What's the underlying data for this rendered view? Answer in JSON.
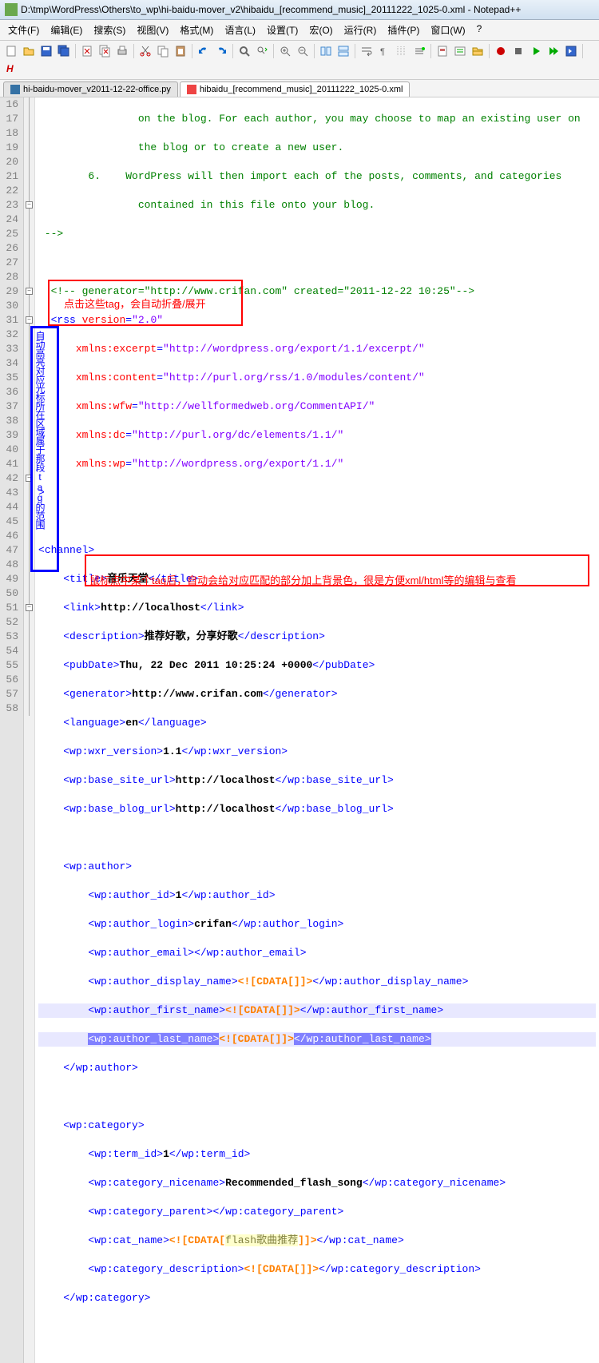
{
  "window": {
    "title": "D:\\tmp\\WordPress\\Others\\to_wp\\hi-baidu-mover_v2\\hibaidu_[recommend_music]_20111222_1025-0.xml - Notepad++"
  },
  "menu": {
    "items": [
      "文件(F)",
      "编辑(E)",
      "搜索(S)",
      "视图(V)",
      "格式(M)",
      "语言(L)",
      "设置(T)",
      "宏(O)",
      "运行(R)",
      "插件(P)",
      "窗口(W)",
      "?"
    ]
  },
  "tabs": {
    "items": [
      {
        "label": "hi-baidu-mover_v2011-12-22-office.py",
        "active": false,
        "type": "py"
      },
      {
        "label": "hibaidu_[recommend_music]_20111222_1025-0.xml",
        "active": true,
        "type": "xml"
      }
    ]
  },
  "annotations": {
    "red1": "点击这些tag，会自动折叠/展开",
    "blue": "自动高亮对应光标所在区域属于那段tag的范围",
    "red2": "鼠标点中某个tag后，自动会给对应匹配的部分加上背景色，很是方便xml/html等的编辑与查看"
  },
  "gutter": {
    "start": 16,
    "end": 58
  },
  "code": {
    "l16": "        on the blog. For each author, you may choose to map an existing user on",
    "l17": "        the blog or to create a new user.",
    "l18": "    6.    WordPress will then import each of the posts, comments, and categories",
    "l19": "        contained in this file onto your blog.",
    "l20": " -->",
    "l21": "",
    "l22t": "<!-- generator=\"http://www.crifan.com\" created=\"2011-12-22 10:25\"-->",
    "l23a": "rss",
    "l23b": "version",
    "l23c": "\"2.0\"",
    "l24a": "xmlns:excerpt",
    "l24b": "\"http://wordpress.org/export/1.1/excerpt/\"",
    "l25a": "xmlns:content",
    "l25b": "\"http://purl.org/rss/1.0/modules/content/\"",
    "l26a": "xmlns:wfw",
    "l26b": "\"http://wellformedweb.org/CommentAPI/\"",
    "l27a": "xmlns:dc",
    "l27b": "\"http://purl.org/dc/elements/1.1/\"",
    "l28a": "xmlns:wp",
    "l28b": "\"http://wordpress.org/export/1.1/\"",
    "l29": ">",
    "l31": "channel",
    "l32a": "title",
    "l32t": "音乐天堂",
    "l33a": "link",
    "l33t": "http://localhost",
    "l34a": "description",
    "l34t": "推荐好歌，分享好歌",
    "l35a": "pubDate",
    "l35t": "Thu, 22 Dec 2011 10:25:24 +0000",
    "l36a": "generator",
    "l36t": "http://www.crifan.com",
    "l37a": "language",
    "l37t": "en",
    "l38a": "wp:wxr_version",
    "l38t": "1.1",
    "l39a": "wp:base_site_url",
    "l39t": "http://localhost",
    "l40a": "wp:base_blog_url",
    "l40t": "http://localhost",
    "l42": "wp:author",
    "l43a": "wp:author_id",
    "l43t": "1",
    "l44a": "wp:author_login",
    "l44t": "crifan",
    "l45a": "wp:author_email",
    "l46a": "wp:author_display_name",
    "l46c": "<![CDATA[]]>",
    "l47a": "wp:author_first_name",
    "l47c": "<![CDATA[]]>",
    "l48a": "wp:author_last_name",
    "l48c": "<![CDATA[]]>",
    "l49": "wp:author",
    "l51": "wp:category",
    "l52a": "wp:term_id",
    "l52t": "1",
    "l53a": "wp:category_nicename",
    "l53t": "Recommended_flash_song",
    "l54a": "wp:category_parent",
    "l55a": "wp:cat_name",
    "l55c1": "<![CDATA[",
    "l55c2": "flash歌曲推荐",
    "l55c3": "]]>",
    "l56a": "wp:category_description",
    "l56c": "<![CDATA[]]>",
    "l57": "wp:category"
  }
}
